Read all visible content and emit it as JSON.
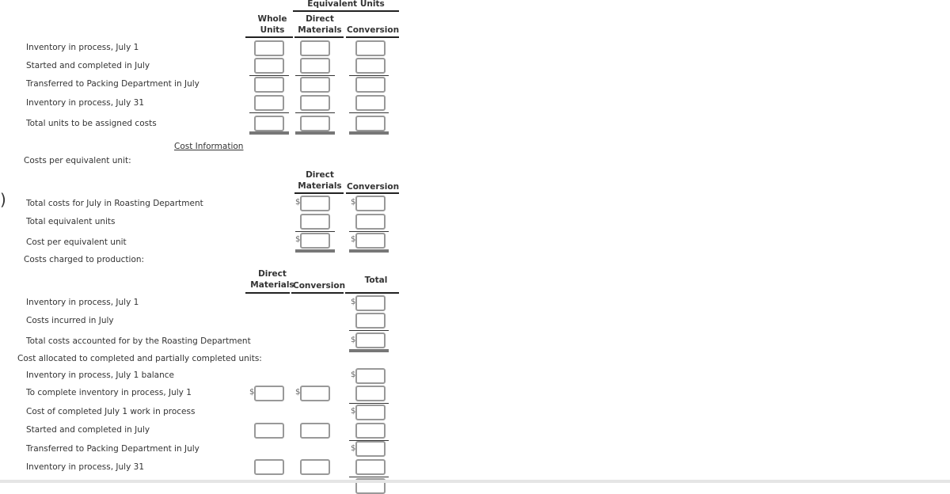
{
  "units": {
    "equiv_header": "Equivalent Units",
    "whole_units": "Whole Units",
    "direct_materials": "Direct Materials",
    "conversion": "Conversion",
    "rows": [
      "Inventory in process, July 1",
      "Started and completed in July",
      "Transferred to Packing Department in July",
      "Inventory in process, July 31",
      "Total units to be assigned costs"
    ]
  },
  "cost_info_link": "Cost Information",
  "cpeu": {
    "heading": "Costs per equivalent unit:",
    "direct_materials": "Direct Materials",
    "conversion": "Conversion",
    "rows": [
      "Total costs for July in Roasting Department",
      "Total equivalent units",
      "Cost per equivalent unit"
    ]
  },
  "charged": {
    "heading": "Costs charged to production:",
    "direct_materials": "Direct Materials",
    "conversion": "Conversion",
    "total": "Total",
    "rows": [
      "Inventory in process, July 1",
      "Costs incurred in July",
      "Total costs accounted for by the Roasting Department"
    ],
    "allocated_heading": "Cost allocated to completed and partially completed units:",
    "alloc_rows": [
      "Inventory in process, July 1 balance",
      "To complete inventory in process, July 1",
      "Cost of completed July 1 work in process",
      "Started and completed in July",
      "Transferred to Packing Department in July",
      "Inventory in process, July 31"
    ]
  },
  "dollar": "$",
  "edge_glyph": ")"
}
